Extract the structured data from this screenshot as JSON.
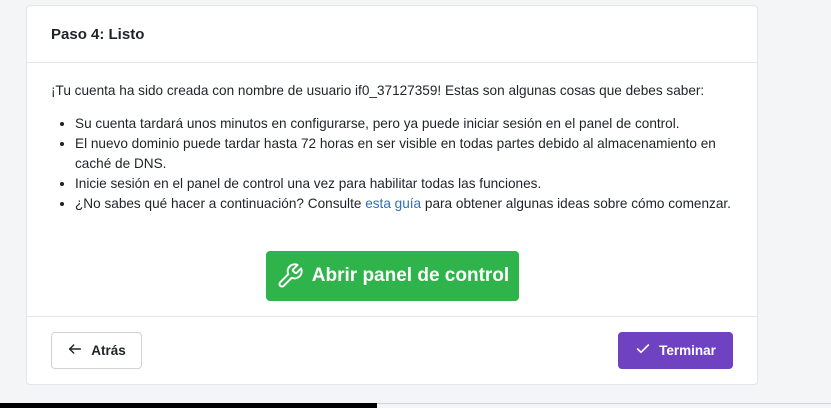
{
  "header": {
    "title": "Paso 4: Listo"
  },
  "body": {
    "intro": "¡Tu cuenta ha sido creada con nombre de usuario if0_37127359! Estas son algunas cosas que debes saber:",
    "tips": [
      "Su cuenta tardará unos minutos en configurarse, pero ya puede iniciar sesión en el panel de control.",
      "El nuevo dominio puede tardar hasta 72 horas en ser visible en todas partes debido al almacenamiento en caché de DNS.",
      "Inicie sesión en el panel de control una vez para habilitar todas las funciones."
    ],
    "tip_guide": {
      "before": "¿No sabes qué hacer a continuación? Consulte ",
      "link": "esta guía",
      "after": " para obtener algunas ideas sobre cómo comenzar."
    },
    "control_panel_button": "Abrir panel de control"
  },
  "footer": {
    "back_label": "Atrás",
    "finish_label": "Terminar"
  },
  "colors": {
    "green": "#2fb44b",
    "purple": "#6f42c1",
    "link": "#2f6fb8"
  },
  "icons": {
    "control_panel": "wrench-icon",
    "back": "arrow-left-icon",
    "finish": "check-icon"
  }
}
